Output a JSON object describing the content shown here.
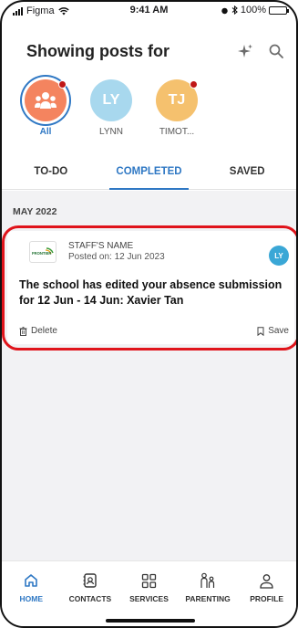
{
  "status": {
    "carrier": "Figma",
    "time": "9:41 AM",
    "battery": "100%",
    "battery_level": 1.0
  },
  "header": {
    "title": "Showing posts for"
  },
  "avatars": [
    {
      "label": "All",
      "initials": "",
      "active": true,
      "has_dot": true
    },
    {
      "label": "LYNN",
      "initials": "LY",
      "active": false,
      "has_dot": false
    },
    {
      "label": "TIMOT...",
      "initials": "TJ",
      "active": false,
      "has_dot": true
    }
  ],
  "tabs": [
    {
      "label": "TO-DO"
    },
    {
      "label": "COMPLETED"
    },
    {
      "label": "SAVED"
    }
  ],
  "feed": {
    "month": "MAY 2022",
    "post": {
      "staff_name": "STAFF'S NAME",
      "posted_on": "Posted on: 12 Jun 2023",
      "badge": "LY",
      "logo_text": "FRONTIER",
      "message": "The school has edited your absence submission for 12 Jun - 14 Jun: Xavier Tan",
      "delete_label": "Delete",
      "save_label": "Save"
    }
  },
  "nav": [
    {
      "label": "HOME",
      "icon": "home-icon"
    },
    {
      "label": "CONTACTS",
      "icon": "contacts-icon"
    },
    {
      "label": "SERVICES",
      "icon": "grid-icon"
    },
    {
      "label": "PARENTING",
      "icon": "parenting-icon"
    },
    {
      "label": "PROFILE",
      "icon": "profile-icon"
    }
  ],
  "colors": {
    "accent": "#2f78c4",
    "highlight": "#e0141b",
    "avatar_all": "#f4845f",
    "avatar_ly": "#a8d8ee",
    "avatar_tj": "#f5c16e",
    "badge": "#3aa7d6"
  }
}
